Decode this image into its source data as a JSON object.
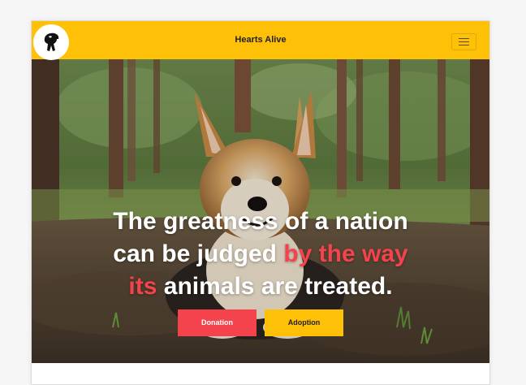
{
  "navbar": {
    "brand": "Hearts Alive",
    "logo_icon": "dog-silhouette-icon",
    "menu_icon": "hamburger-menu-icon",
    "background": "#ffc107"
  },
  "hero": {
    "image": "corgi-dog-in-forest",
    "headline_line1": "The greatness of a nation",
    "headline_line2_a": "can be judged ",
    "headline_line2_accent": "by the way",
    "headline_line3_accent": "its",
    "headline_line3_b": " animals are treated.",
    "accent_color": "#f4434d",
    "buttons": {
      "donation": "Donation",
      "adoption": "Adoption"
    }
  }
}
